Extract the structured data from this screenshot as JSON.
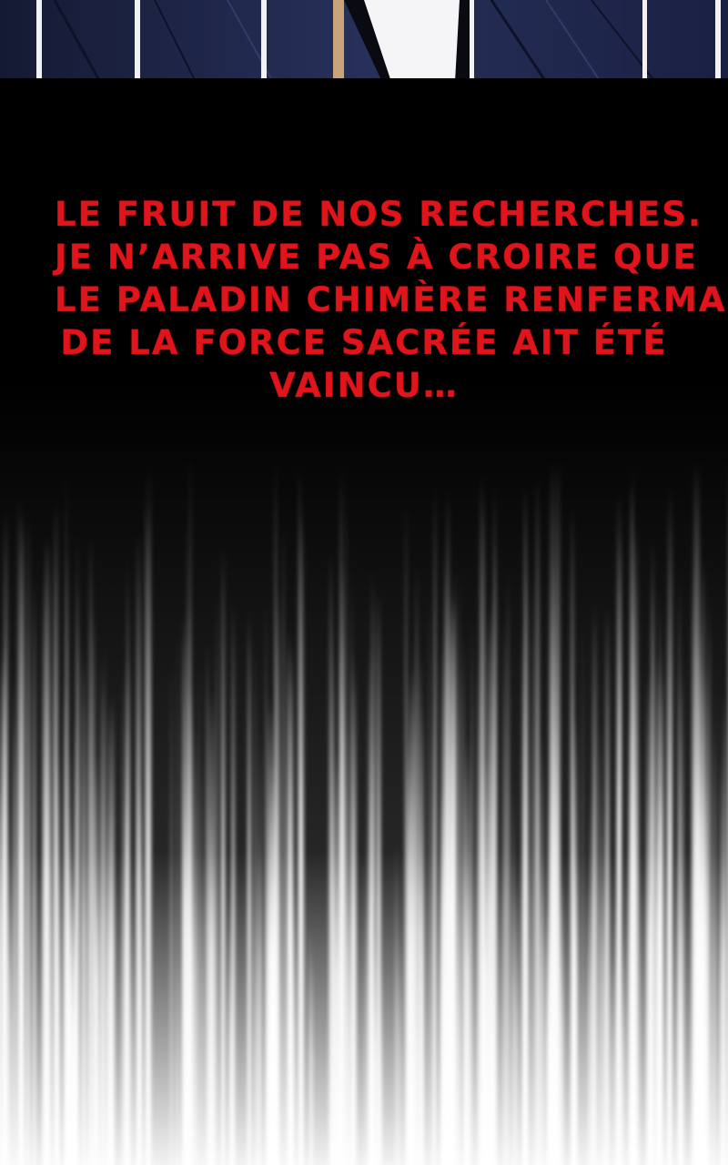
{
  "panel": {
    "narration_lines": [
      "LE FRUIT DE NOS RECHERCHES.",
      "JE N’ARRIVE PAS À CROIRE QUE",
      "LE PALADIN CHIMÈRE RENFERMANT",
      "DE LA FORCE SACRÉE AIT ÉTÉ",
      "VAINCU…"
    ]
  },
  "colors": {
    "background": "#000000",
    "narration_text": "#e0151b",
    "fabric": "#1c2240",
    "frame_bars": "#f2f2f4",
    "fade_white": "#ffffff"
  }
}
